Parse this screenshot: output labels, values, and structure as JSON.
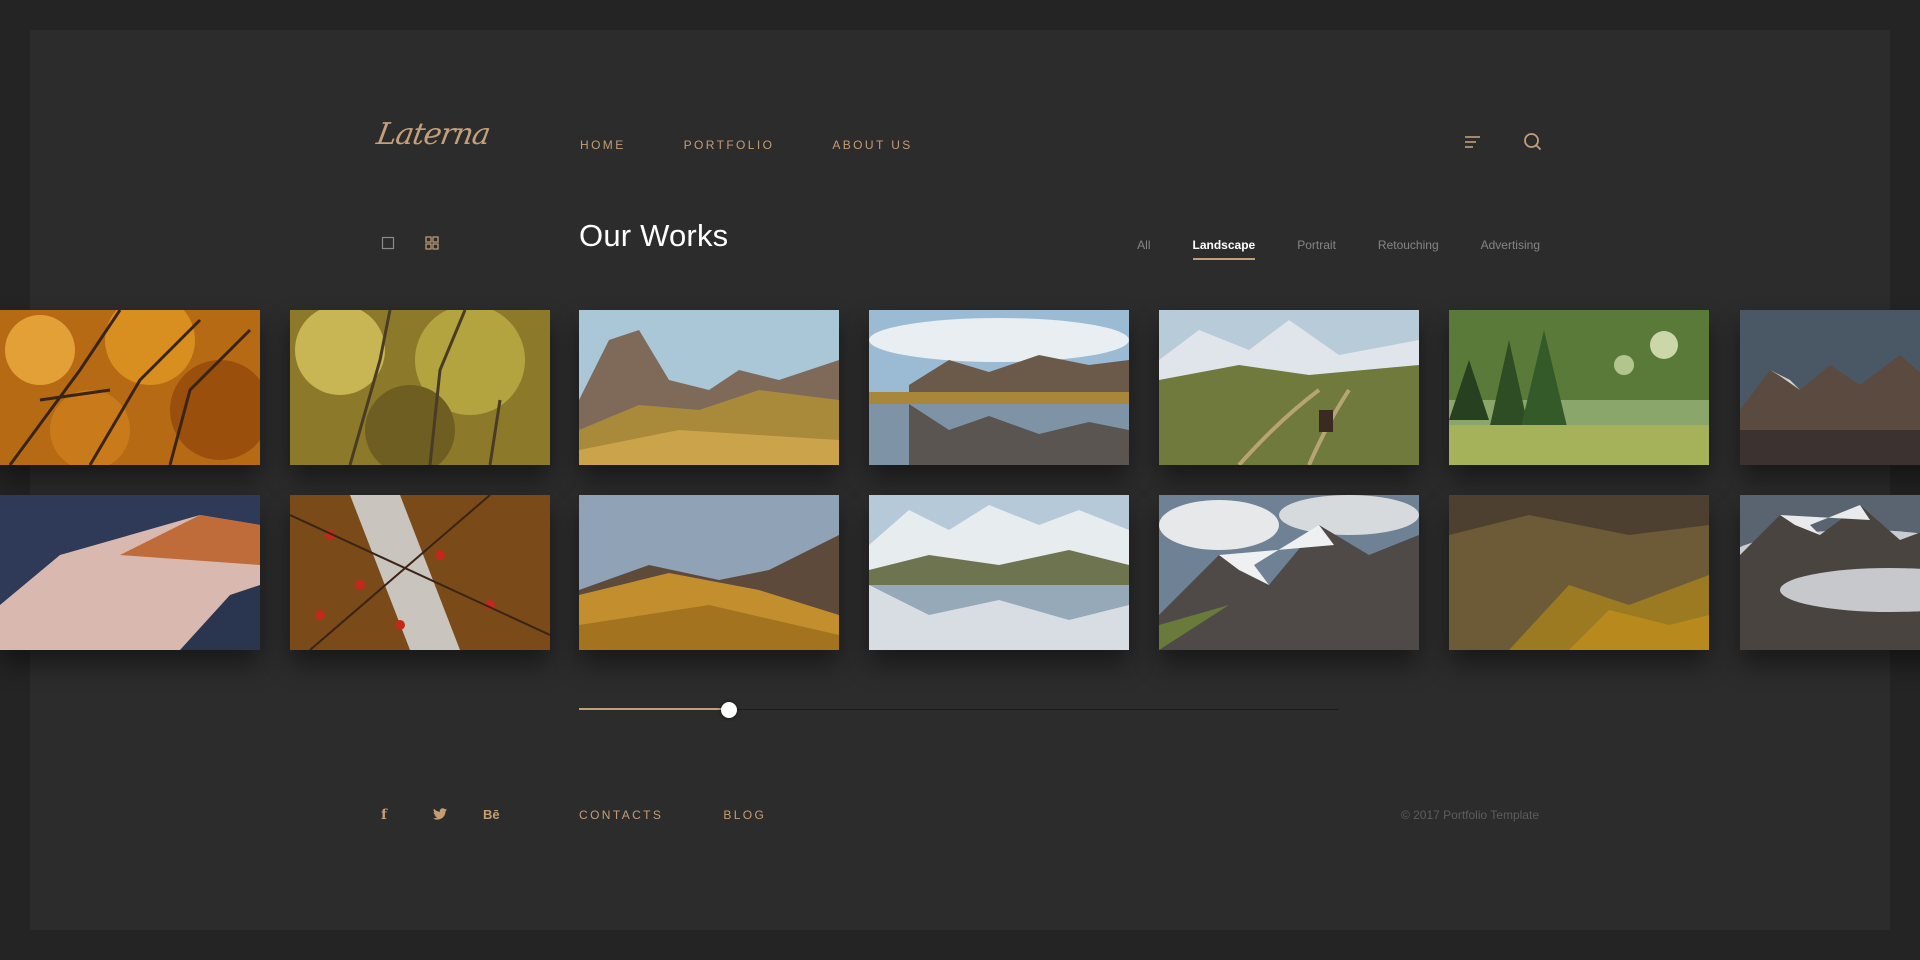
{
  "header": {
    "logo_text": "Laterna",
    "nav": [
      {
        "label": "HOME"
      },
      {
        "label": "PORTFOLIO"
      },
      {
        "label": "ABOUT US"
      }
    ],
    "menu_icon": "menu-icon",
    "search_icon": "search-icon"
  },
  "main": {
    "title": "Our Works",
    "view_toggles": [
      "single-view-icon",
      "grid-view-icon"
    ],
    "filters": [
      {
        "label": "All",
        "active": false
      },
      {
        "label": "Landscape",
        "active": true
      },
      {
        "label": "Portrait",
        "active": false
      },
      {
        "label": "Retouching",
        "active": false
      },
      {
        "label": "Advertising",
        "active": false
      }
    ],
    "gallery": {
      "rows": 2,
      "items_per_row_visible": 7
    },
    "slider": {
      "value_fraction": 0.197
    }
  },
  "footer": {
    "social": [
      {
        "name": "facebook-icon",
        "glyph": "f"
      },
      {
        "name": "twitter-icon",
        "glyph": "🐦"
      },
      {
        "name": "behance-icon",
        "glyph": "Bē"
      }
    ],
    "links": [
      {
        "label": "CONTACTS"
      },
      {
        "label": "BLOG"
      }
    ],
    "copyright": "© 2017 Portfolio Template"
  },
  "colors": {
    "background": "#242424",
    "panel": "#2c2c2c",
    "accent": "#c4a07a",
    "text_primary": "#ffffff",
    "text_muted": "#858585"
  }
}
